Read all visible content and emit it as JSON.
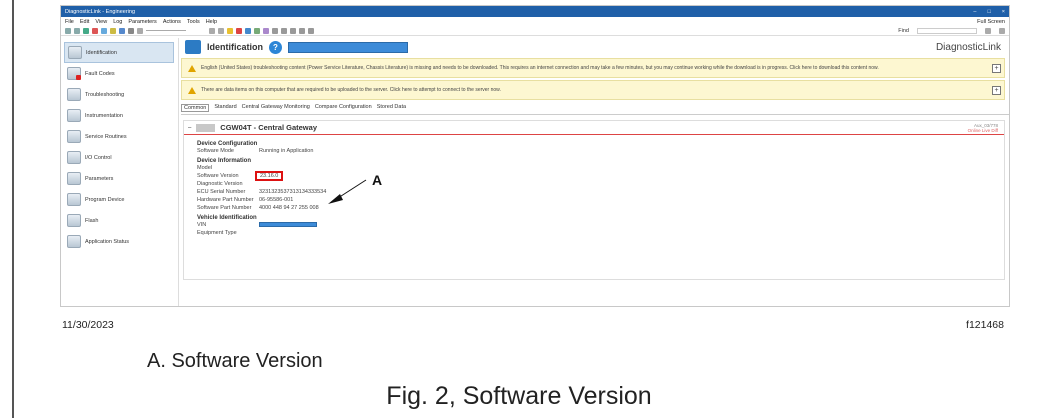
{
  "window": {
    "title": "DiagnosticLink - Engineering",
    "controls": [
      "–",
      "□",
      "×"
    ]
  },
  "menubar": {
    "items": [
      "File",
      "Edit",
      "View",
      "Log",
      "Parameters",
      "Actions",
      "Tools",
      "Help"
    ],
    "full_screen": "Full Screen"
  },
  "toolbar": {
    "find_label": "Find"
  },
  "sidebar": {
    "items": [
      {
        "label": "Identification",
        "icon": "identification-icon",
        "active": true
      },
      {
        "label": "Fault Codes",
        "icon": "fault-codes-icon"
      },
      {
        "label": "Troubleshooting",
        "icon": "troubleshooting-icon"
      },
      {
        "label": "Instrumentation",
        "icon": "instrumentation-icon"
      },
      {
        "label": "Service Routines",
        "icon": "service-routines-icon"
      },
      {
        "label": "I/O Control",
        "icon": "io-control-icon"
      },
      {
        "label": "Parameters",
        "icon": "parameters-icon"
      },
      {
        "label": "Program Device",
        "icon": "program-device-icon"
      },
      {
        "label": "Flash",
        "icon": "flash-icon"
      },
      {
        "label": "Application Status",
        "icon": "application-status-icon"
      }
    ]
  },
  "main": {
    "title": "Identification",
    "brand": "DiagnosticLink",
    "warnings": [
      "English (United States) troubleshooting content (Power Service Literature, Chassis Literature) is missing and needs to be downloaded. This requires an internet connection and may take a few minutes, but you may continue working while the download is in progress. Click here to download this content now.",
      "There are data items on this computer that are required to be uploaded to the server. Click here to attempt to connect to the server now."
    ],
    "tabs": [
      "Common",
      "Standard",
      "Central Gateway Monitoring",
      "Compare Configuration",
      "Stored Data"
    ],
    "ecu": {
      "title": "CGW04T - Central Gateway",
      "right_line1": "Aux_03/778",
      "right_line2": "Online Live Diff"
    },
    "device_config": {
      "heading": "Device Configuration",
      "rows": [
        {
          "k": "Software Mode",
          "v": "Running in Application"
        }
      ]
    },
    "device_info": {
      "heading": "Device Information",
      "rows": [
        {
          "k": "Model",
          "v": ""
        },
        {
          "k": "Software Version",
          "v": "23.16.0"
        },
        {
          "k": "Diagnostic Version",
          "v": ""
        },
        {
          "k": "ECU Serial Number",
          "v": "3231323537313134333534"
        },
        {
          "k": "Hardware Part Number",
          "v": "06-95586-001"
        },
        {
          "k": "Software Part Number",
          "v": "4000 448 94 27 255 008"
        }
      ]
    },
    "vehicle_id": {
      "heading": "Vehicle Identification",
      "rows": [
        {
          "k": "VIN",
          "v": ""
        },
        {
          "k": "Equipment Type",
          "v": ""
        }
      ]
    }
  },
  "callout": {
    "letter": "A"
  },
  "footer": {
    "date": "11/30/2023",
    "figure_ref": "f121468",
    "legend": "A. Software Version",
    "caption": "Fig. 2, Software Version"
  }
}
